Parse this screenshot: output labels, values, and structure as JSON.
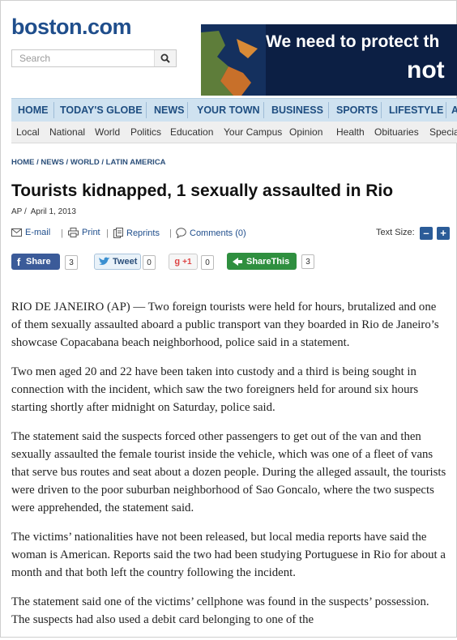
{
  "header": {
    "logo": "boston.com",
    "search_placeholder": "Search",
    "banner_line1": "We need to protect th",
    "banner_line2": "not"
  },
  "nav_primary": [
    "HOME",
    "TODAY'S GLOBE",
    "NEWS",
    "YOUR TOWN",
    "BUSINESS",
    "SPORTS",
    "LIFESTYLE",
    "A"
  ],
  "nav_secondary": [
    "Local",
    "National",
    "World",
    "Politics",
    "Education",
    "Your Campus",
    "Opinion",
    "Health",
    "Obituaries",
    "Specia"
  ],
  "breadcrumb": [
    "HOME",
    "NEWS",
    "WORLD",
    "LATIN AMERICA"
  ],
  "article": {
    "title": "Tourists kidnapped, 1 sexually assaulted in Rio",
    "source": "AP",
    "date": "April 1, 2013",
    "paragraphs": [
      "RIO DE JANEIRO (AP) — Two foreign tourists were held for hours, brutalized and one of them sexually assaulted aboard a public transport van they boarded in Rio de Janeiro’s showcase Copacabana beach neighborhood, police said in a statement.",
      "Two men aged 20 and 22 have been taken into custody and a third is being sought in connection with the incident, which saw the two foreigners held for around six hours starting shortly after midnight on Saturday, police said.",
      "The statement said the suspects forced other passengers to get out of the van and then sexually assaulted the female tourist inside the vehicle, which was one of a fleet of vans that serve bus routes and seat about a dozen people. During the alleged assault, the tourists were driven to the poor suburban neighborhood of Sao Goncalo, where the two suspects were apprehended, the statement said.",
      "The victims’ nationalities have not been released, but local media reports have said the woman is American. Reports said the two had been studying Portuguese in Rio for about a month and that both left the country following the incident.",
      "The statement said one of the victims’ cellphone was found in the suspects’ possession. The suspects had also used a debit card belonging to one of the"
    ]
  },
  "tools": {
    "email": "E-mail",
    "print": "Print",
    "reprints": "Reprints",
    "comments": "Comments (0)",
    "text_size_label": "Text Size:",
    "minus": "–",
    "plus": "+"
  },
  "share": {
    "facebook_label": "Share",
    "facebook_count": "3",
    "twitter_label": "Tweet",
    "twitter_count": "0",
    "gplus_label": "+1",
    "gplus_count": "0",
    "sharethis_label": "ShareThis",
    "sharethis_count": "3"
  },
  "colors": {
    "brand_blue": "#1f4e8c",
    "nav_bg": "#cfe2f0",
    "facebook": "#3b5b99",
    "sharethis": "#2f8f3f"
  }
}
